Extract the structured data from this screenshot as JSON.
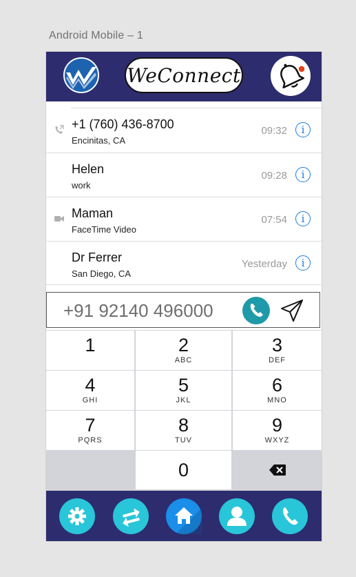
{
  "artboard_title": "Android Mobile – 1",
  "header": {
    "brand": "WeConnect",
    "logo_icon": "weconnect-w-logo",
    "notification_icon": "bell-icon",
    "notification_badge_color": "#e8401c"
  },
  "recents": [
    {
      "name": "+1 (760) 436-8700",
      "sub": "Encinitas, CA",
      "time": "09:32",
      "type_icon": "phone-outgoing-icon"
    },
    {
      "name": "Helen",
      "sub": "work",
      "time": "09:28",
      "type_icon": ""
    },
    {
      "name": "Maman",
      "sub": "FaceTime Video",
      "time": "07:54",
      "type_icon": "video-icon"
    },
    {
      "name": "Dr Ferrer",
      "sub": "San Diego, CA",
      "time": "Yesterday",
      "type_icon": ""
    }
  ],
  "info_glyph": "i",
  "dialer": {
    "number": "+91 92140 496000",
    "call_icon": "phone-icon",
    "send_icon": "send-icon"
  },
  "keypad": [
    {
      "num": "1",
      "letters": ""
    },
    {
      "num": "2",
      "letters": "ABC"
    },
    {
      "num": "3",
      "letters": "DEF"
    },
    {
      "num": "4",
      "letters": "GHI"
    },
    {
      "num": "5",
      "letters": "JKL"
    },
    {
      "num": "6",
      "letters": "MNO"
    },
    {
      "num": "7",
      "letters": "PQRS"
    },
    {
      "num": "8",
      "letters": "TUV"
    },
    {
      "num": "9",
      "letters": "WXYZ"
    },
    {
      "num": "0",
      "letters": ""
    }
  ],
  "bottom_nav": [
    "gear-icon",
    "swap-icon",
    "home-icon",
    "contact-icon",
    "phone-icon"
  ],
  "colors": {
    "header_bg": "#2d2c6e",
    "accent_teal": "#29c5d8",
    "call_button": "#1e9aa8",
    "info_blue": "#1a7be0"
  }
}
